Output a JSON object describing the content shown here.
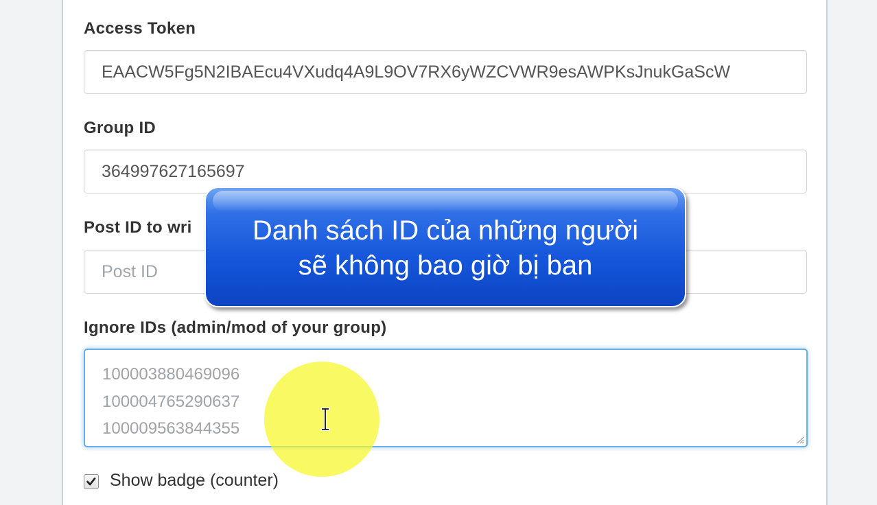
{
  "form": {
    "access_token": {
      "label": "Access Token",
      "value": "EAACW5Fg5N2IBAEcu4VXudq4A9L9OV7RX6yWZCVWR9esAWPKsJnukGaScW"
    },
    "group_id": {
      "label": "Group ID",
      "value": "364997627165697"
    },
    "post_id": {
      "label": "Post ID to wri",
      "placeholder": "Post ID"
    },
    "ignore_ids": {
      "label": "Ignore IDs (admin/mod of your group)",
      "lines": [
        "100003880469096",
        "100004765290637",
        "100009563844355"
      ]
    },
    "show_badge": {
      "label": "Show badge (counter)",
      "checked": true
    }
  },
  "overlay": {
    "caption_line1": "Danh sách ID của những người",
    "caption_line2": "sẽ không bao giờ bị ban"
  },
  "icons": {
    "cursor": "text-cursor-icon",
    "check": "checkmark-icon",
    "resize": "resize-grip-icon"
  },
  "colors": {
    "focus_border": "#66afe9",
    "banner_blue": "#1556db",
    "highlight_yellow": "#f6f628"
  }
}
